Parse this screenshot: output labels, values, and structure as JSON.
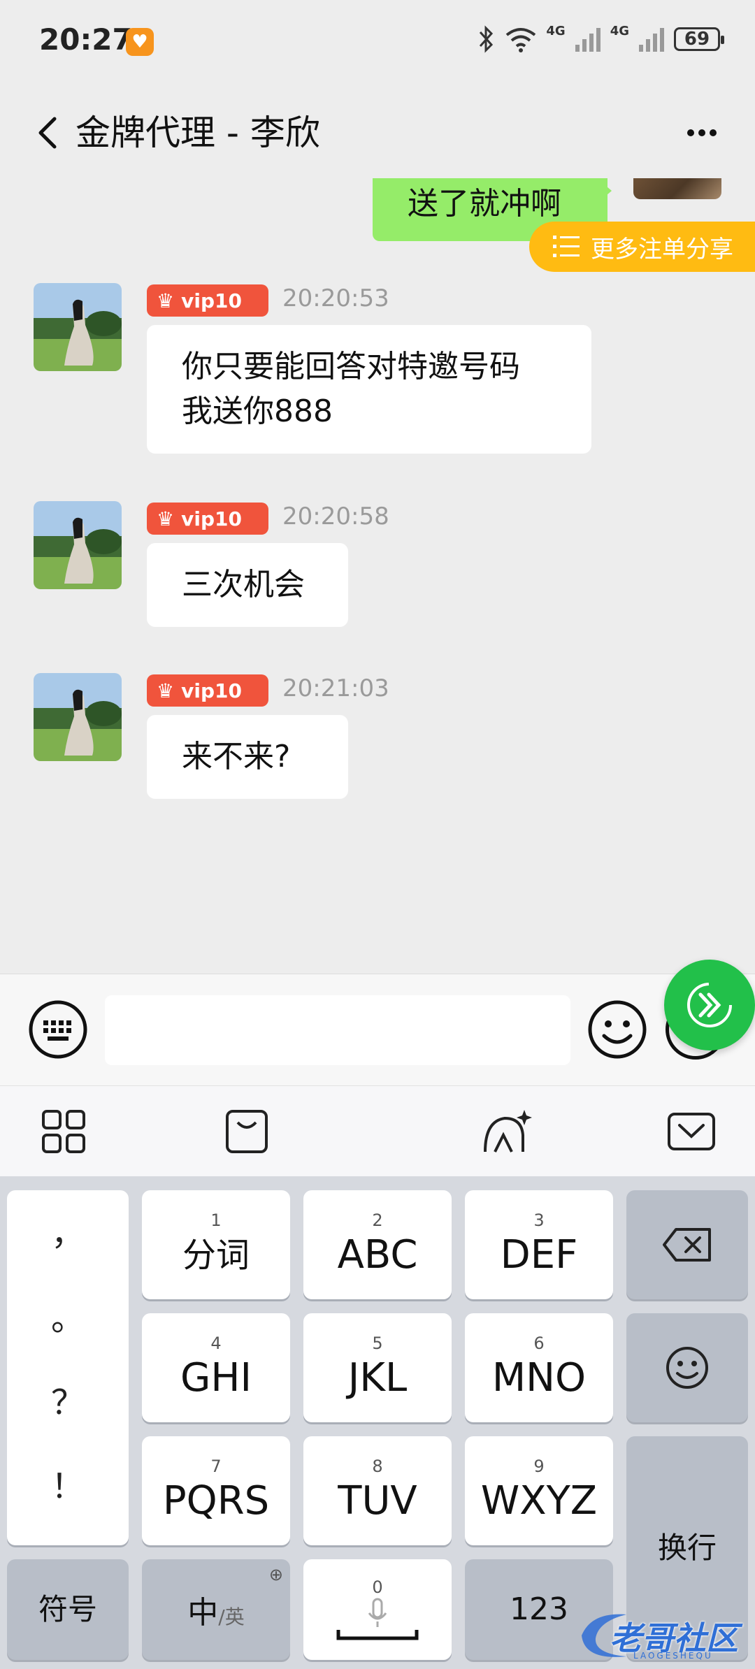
{
  "status_bar": {
    "time": "20:27",
    "app_badge_icon": "heart-app-icon",
    "net1": "4G",
    "net2": "4G",
    "battery": "69"
  },
  "header": {
    "title": "金牌代理 - 李欣"
  },
  "chat": {
    "my_message": "送了就冲啊",
    "more_share_label": "更多注单分享",
    "messages": [
      {
        "badge": "vip10",
        "time": "20:20:53",
        "lines": [
          "你只要能回答对特邀号码",
          "我送你888"
        ]
      },
      {
        "badge": "vip10",
        "time": "20:20:58",
        "lines": [
          "三次机会"
        ]
      },
      {
        "badge": "vip10",
        "time": "20:21:03",
        "lines": [
          "来不来?"
        ]
      }
    ]
  },
  "input_bar": {
    "value": "",
    "placeholder": ""
  },
  "keyboard": {
    "punctuation": [
      "，",
      "。",
      "？",
      "！"
    ],
    "keys": [
      {
        "num": "1",
        "label": "分词"
      },
      {
        "num": "2",
        "label": "ABC"
      },
      {
        "num": "3",
        "label": "DEF"
      },
      {
        "num": "4",
        "label": "GHI"
      },
      {
        "num": "5",
        "label": "JKL"
      },
      {
        "num": "6",
        "label": "MNO"
      },
      {
        "num": "7",
        "label": "PQRS"
      },
      {
        "num": "8",
        "label": "TUV"
      },
      {
        "num": "9",
        "label": "WXYZ"
      }
    ],
    "symbols_label": "符号",
    "lang_label_main": "中",
    "lang_label_sub": "/英",
    "space_num": "0",
    "numbers_label": "123",
    "enter_label": "换行"
  },
  "watermark": {
    "text": "老哥社区",
    "sub": "LAOGESHEQU"
  },
  "colors": {
    "my_bubble": "#95ec69",
    "vip_badge": "#f0543c",
    "share_banner": "#ffbb12",
    "fab": "#22c04a"
  }
}
